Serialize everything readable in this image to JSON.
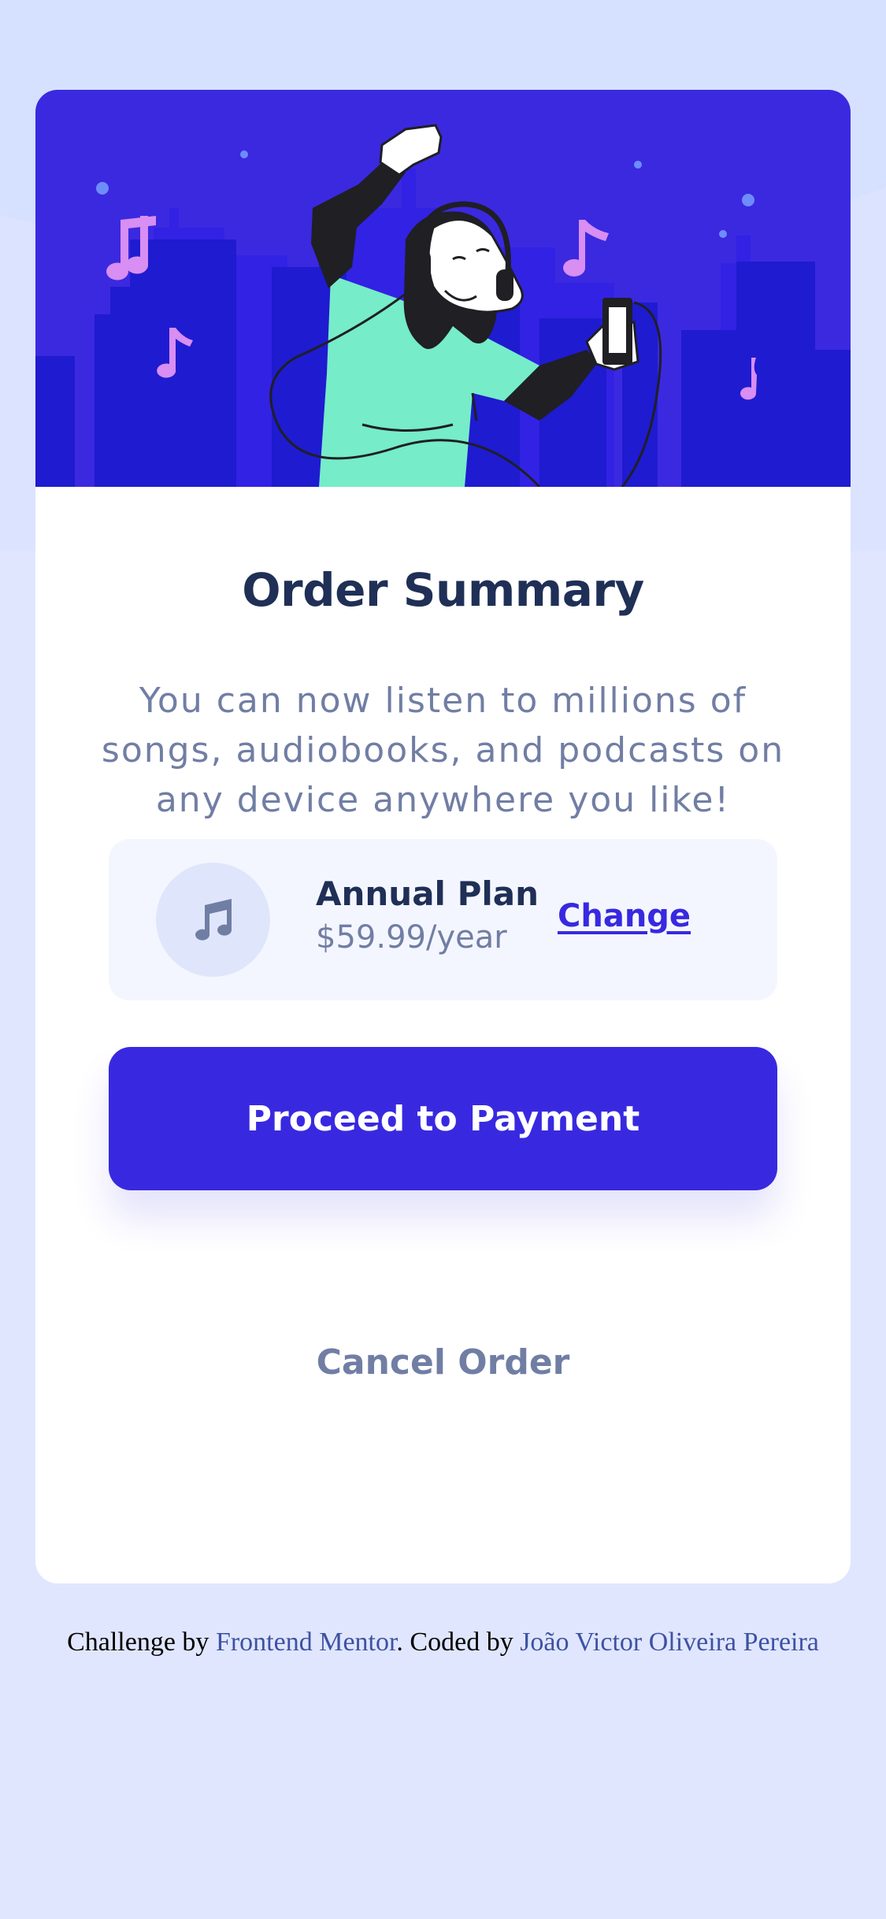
{
  "colors": {
    "page_background": "#e0e6fd",
    "primary": "#3829e0",
    "dark_text": "#1f2f56",
    "muted_text": "#717ea4",
    "plan_background": "#f4f6ff",
    "hero_accent": "#76ecc9"
  },
  "hero": {
    "illustration": "person-dancing-with-headphones-city-skyline-illustration"
  },
  "order": {
    "title": "Order Summary",
    "description": "You can now listen to millions of songs, audiobooks, and podcasts on any device anywhere you like!"
  },
  "plan": {
    "icon": "music-note-icon",
    "name": "Annual Plan",
    "price": "$59.99/year",
    "change_label": "Change"
  },
  "actions": {
    "proceed_label": "Proceed to Payment",
    "cancel_label": "Cancel Order"
  },
  "attribution": {
    "prefix": "Challenge by ",
    "challenge_link": "Frontend Mentor",
    "middle": ". Coded by ",
    "author_link": "João Victor Oliveira Pereira"
  }
}
